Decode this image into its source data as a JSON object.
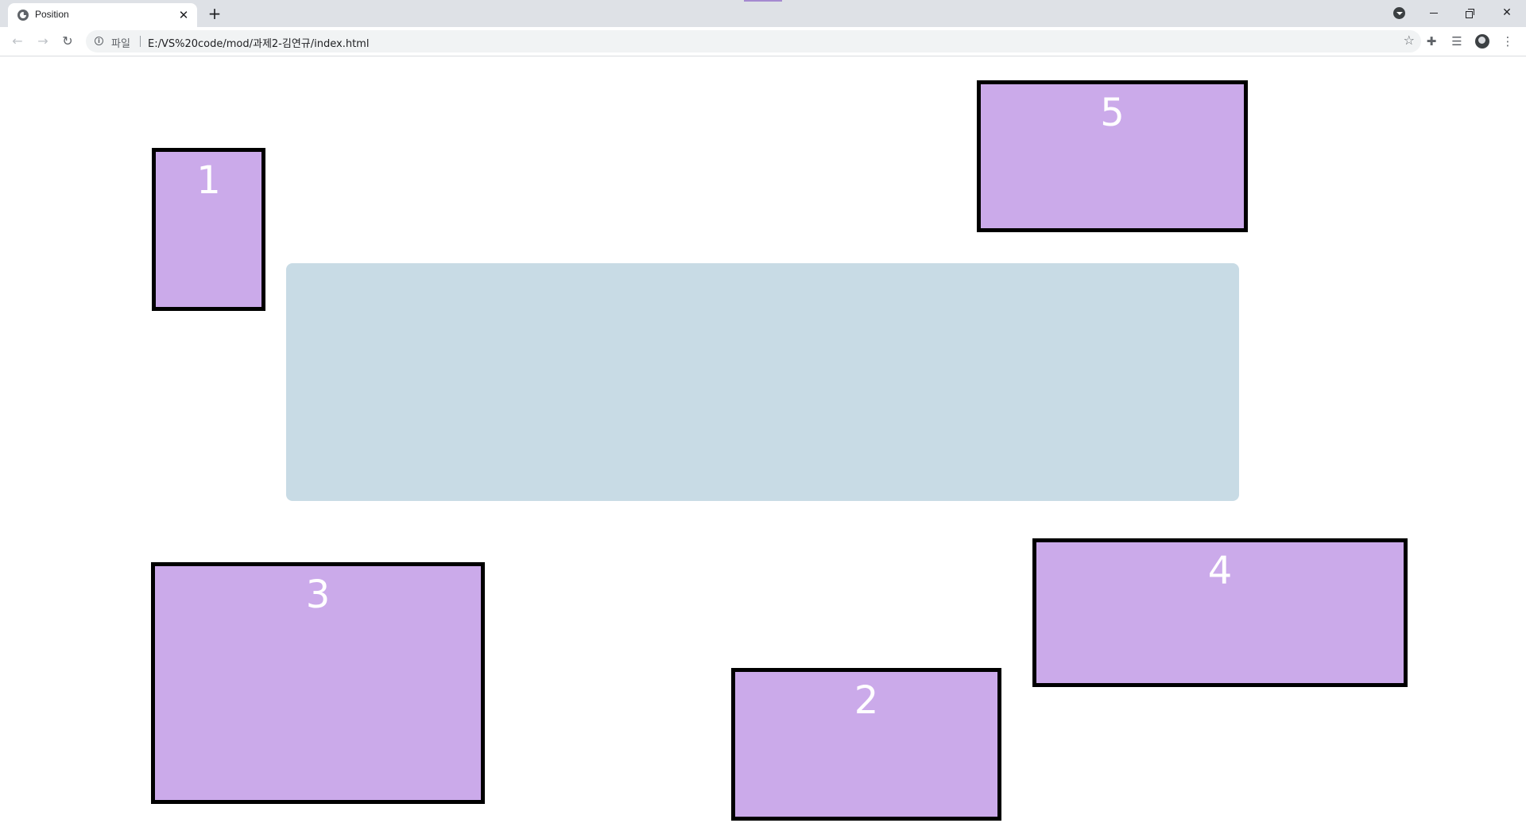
{
  "browser": {
    "tab": {
      "title": "Position",
      "close_glyph": "✕"
    },
    "new_tab_glyph": "+",
    "window_controls": {
      "close_glyph": "✕"
    },
    "toolbar": {
      "back_glyph": "←",
      "forward_glyph": "→",
      "reload_glyph": "↻",
      "scheme_label": "파일",
      "url": "E:/VS%20code/mod/과제2-김연규/index.html",
      "bookmark_glyph": "☆",
      "extensions_glyph": "✚",
      "media_glyph": "☰",
      "menu_glyph": "⋮"
    }
  },
  "page": {
    "panel_color": "#c8dbe5",
    "box_color": "#cbaaea",
    "box_border_color": "#000000",
    "boxes": [
      {
        "id": "box-1",
        "label": "1"
      },
      {
        "id": "box-5",
        "label": "5"
      },
      {
        "id": "box-3",
        "label": "3"
      },
      {
        "id": "box-2",
        "label": "2"
      },
      {
        "id": "box-4",
        "label": "4"
      }
    ]
  }
}
